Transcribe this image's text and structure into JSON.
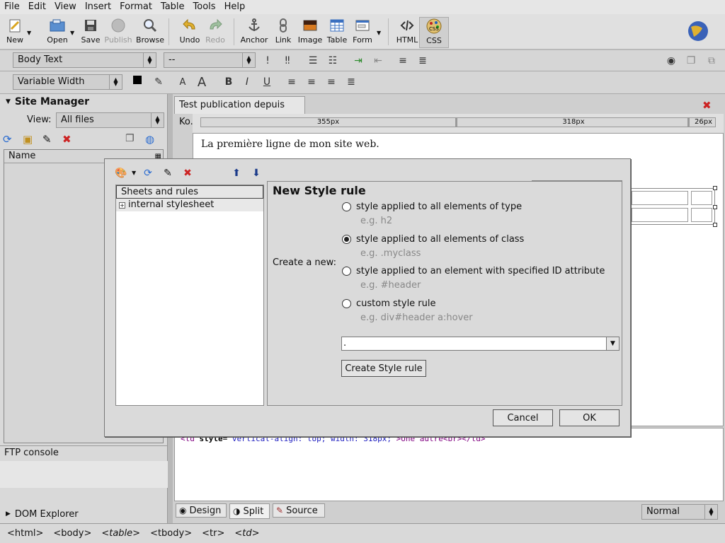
{
  "menubar": [
    "File",
    "Edit",
    "View",
    "Insert",
    "Format",
    "Table",
    "Tools",
    "Help"
  ],
  "toolbar": {
    "new": "New",
    "open": "Open",
    "save": "Save",
    "publish": "Publish",
    "browse": "Browse",
    "undo": "Undo",
    "redo": "Redo",
    "anchor": "Anchor",
    "link": "Link",
    "image": "Image",
    "table": "Table",
    "form": "Form",
    "html": "HTML",
    "css": "CSS"
  },
  "format": {
    "paragraph_style": "Body Text",
    "font_size": "--",
    "font_family": "Variable Width"
  },
  "sidebar": {
    "title": "Site Manager",
    "view_label": "View:",
    "view_value": "All files",
    "name_header": "Name",
    "ftp_console": "FTP console",
    "dom_explorer": "DOM Explorer"
  },
  "editor": {
    "tab_title": "Test publication depuis Ko...",
    "ruler": [
      "355px",
      "318px",
      "26px"
    ],
    "content_line": "La première ligne de mon site web.",
    "source_line": {
      "tag_open": "<td ",
      "attr": "style",
      "eq": "=",
      "value": "\"vertical-align: top; width: 318px;\"",
      "text": ">Une autre",
      "br": "<br>",
      "tag_close": "</td>"
    },
    "view_tabs": [
      "Design",
      "Split",
      "Source"
    ],
    "mode": "Normal"
  },
  "breadcrumbs": [
    "<html>",
    "<body>",
    "<table>",
    "<tbody>",
    "<tr>",
    "<td>"
  ],
  "dialog": {
    "tree_header": "Sheets and rules",
    "tree_item": "internal stylesheet",
    "panel_title": "New Style rule",
    "create_label": "Create a new:",
    "options": [
      {
        "label": "style applied to all elements of type",
        "hint": "e.g. h2",
        "selected": false
      },
      {
        "label": "style applied to all elements of class",
        "hint": "e.g. .myclass",
        "selected": true
      },
      {
        "label": "style applied to an element with specified ID attribute",
        "hint": "e.g. #header",
        "selected": false
      },
      {
        "label": "custom style rule",
        "hint": "e.g. div#header a:hover",
        "selected": false
      }
    ],
    "selector_value": ".",
    "create_button": "Create Style rule",
    "cancel": "Cancel",
    "ok": "OK"
  },
  "colors": {
    "close_red": "#cc2222",
    "accent_blue": "#2a5db0"
  }
}
